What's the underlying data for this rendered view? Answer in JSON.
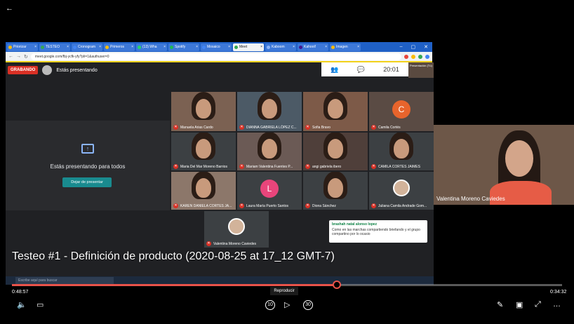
{
  "player": {
    "back_label": "←",
    "current_time": "0:48:57",
    "duration": "0:34:32",
    "progress_fraction": 0.59,
    "tooltip": "Reproducir",
    "caption": "Testeo #1 - Definición de producto (2020-08-25 at 17_12 GMT-7)",
    "skip_back": "10",
    "skip_fwd": "30"
  },
  "meet": {
    "recording_label": "GRABANDO",
    "presenting_label": "Estás presentando",
    "present_message": "Estás presentando para todos",
    "stop_button": "Dejar de presentar",
    "clock": "20:01",
    "present_thumb": "Presentación (Tú)",
    "side_cam_name": "Valentina Moreno Caviedes",
    "participants": [
      {
        "name": "Manuela Arias Cardo"
      },
      {
        "name": "DIANNA GABRIELA LÓPEZ C..."
      },
      {
        "name": "Sofia Bravo"
      },
      {
        "name": "Camila Cortés",
        "initial": "C",
        "color": "#e8642c"
      },
      {
        "name": "Maria Del Mar Moreno Barrios"
      },
      {
        "name": "Mariam Valentina Fuentes P..."
      },
      {
        "name": "angi gabriela ibero"
      },
      {
        "name": "CAMILA CORTES JAIMES"
      },
      {
        "name": "KAREN DANIELA CORTES JA..."
      },
      {
        "name": "Laura María Puerto Santos",
        "initial": "L",
        "color": "#e8457b"
      },
      {
        "name": "Diona Sánchez"
      },
      {
        "name": "Juliana Camila Andrade Gom..."
      },
      {
        "name": "Valentina Moreno Caviedes"
      }
    ],
    "notification": {
      "name": "brashah natal alonso lopez",
      "text": "Como en las marchas compartiendo briefando y el grupo compartino por lo ocasio"
    }
  },
  "browser": {
    "url": "meet.google.com/fbj-ycfk-yfy?pli=1&authuser=0",
    "tabs": [
      "Priorizar",
      "TESTEO",
      "Cronogram",
      "Primeros",
      "(13) Wha",
      "Spotify",
      "Mosaico",
      "Meet",
      "Kaboom",
      "Kahoot!",
      "Imagen"
    ]
  },
  "taskbar": {
    "search_placeholder": "Escribe aquí para buscar"
  },
  "colors": {
    "accent": "#e8534a",
    "meet_bg": "#202124",
    "rec": "#d93025"
  }
}
